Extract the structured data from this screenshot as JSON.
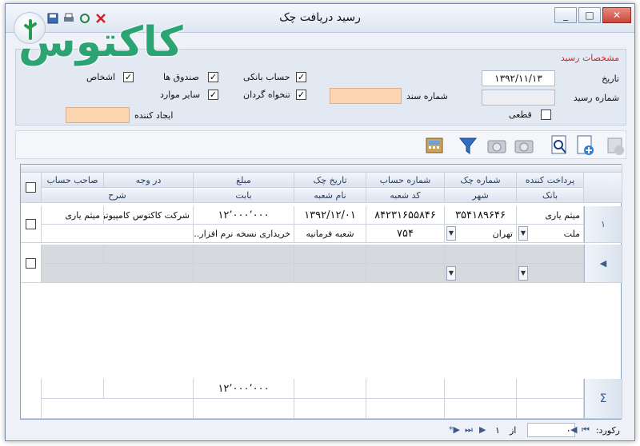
{
  "window": {
    "title": "رسید دریافت چک",
    "minimize": "_",
    "maximize": "□",
    "close": "✕"
  },
  "logo": {
    "text": "کاکتوس"
  },
  "form": {
    "section_title": "مشخصات رسید",
    "date_label": "تاریخ",
    "date_value": "۱۳۹۲/۱۱/۱۳",
    "receipt_no_label": "شماره رسید",
    "receipt_no_value": "",
    "doc_no_label": "شماره سند",
    "doc_no_value": "",
    "creator_label": "ایجاد کننده",
    "creator_value": "",
    "final_label": "قطعی",
    "checkboxes": {
      "bank_account": "حساب بانکی",
      "cash_box": "صندوق ها",
      "persons": "اشخاص",
      "petty_cash": "تنخواه گردان",
      "other": "سایر موارد"
    }
  },
  "grid": {
    "headers_row1": {
      "payer": "پرداخت کننده",
      "check_no": "شماره چک",
      "account_no": "شماره حساب",
      "check_date": "تاریخ چک",
      "amount": "مبلغ",
      "payee": "در وجه",
      "account_owner": "صاحب حساب"
    },
    "headers_row2": {
      "bank": "بانک",
      "city": "شهر",
      "branch_code": "کد شعبه",
      "branch_name": "نام شعبه",
      "for": "بابت",
      "description": "شرح"
    },
    "rows": [
      {
        "index": "۱",
        "payer": "میثم یاری",
        "check_no": "۳۵۴۱۸۹۶۴۶",
        "account_no": "۸۴۲۳۱۶۵۵۸۴۶",
        "check_date": "۱۳۹۲/۱۲/۰۱",
        "amount": "۱۲٬۰۰۰٬۰۰۰",
        "payee": "شرکت کاکتوس کامپیوتر",
        "account_owner": "میثم یاری",
        "bank": "ملت",
        "city": "تهران",
        "branch_code": "۷۵۴",
        "branch_name": "شعبه فرمانیه",
        "for": "خریداری نسخه نرم افزار...",
        "description": ""
      }
    ],
    "footer": {
      "sum_symbol": "Σ",
      "amount_total": "۱۲٬۰۰۰٬۰۰۰"
    }
  },
  "status": {
    "records_label": "رکورد:",
    "current": "۰",
    "of_label": "از",
    "total": "۱"
  }
}
